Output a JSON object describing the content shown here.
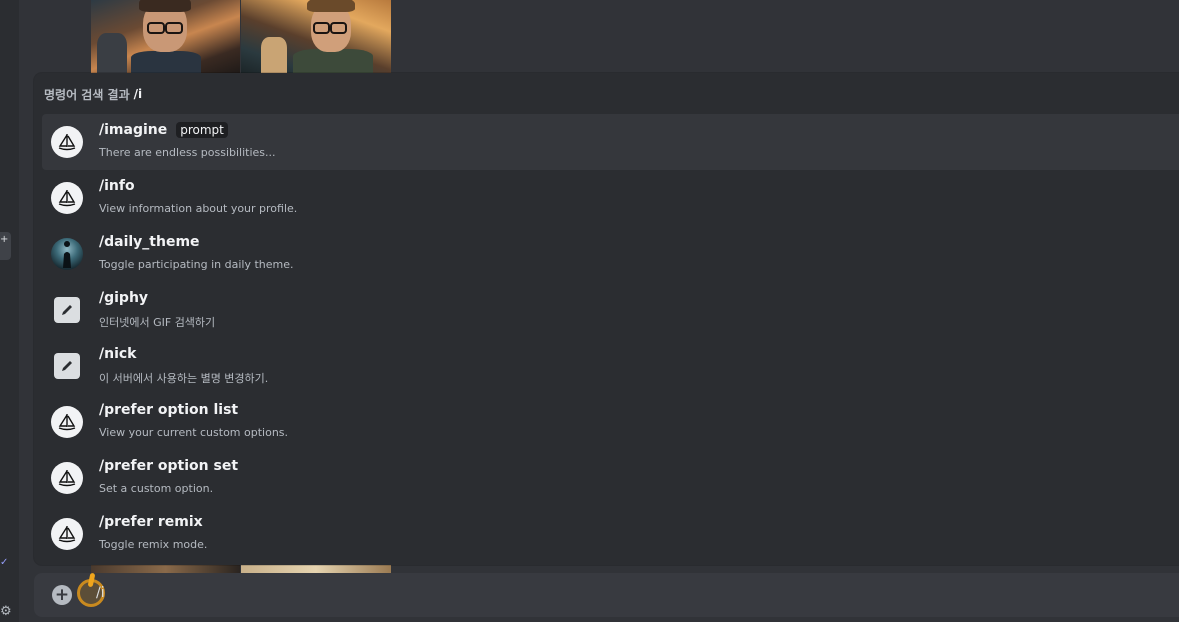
{
  "popup": {
    "header_label": "명령어 검색 결과",
    "header_query": "/i",
    "commands": [
      {
        "name": "/imagine",
        "param": "prompt",
        "description": "There are endless possibilities...",
        "icon": "midjourney-boat-icon"
      },
      {
        "name": "/info",
        "param": "",
        "description": "View information about your profile.",
        "icon": "midjourney-boat-icon"
      },
      {
        "name": "/daily_theme",
        "param": "",
        "description": "Toggle participating in daily theme.",
        "icon": "daily-theme-avatar-icon"
      },
      {
        "name": "/giphy",
        "param": "",
        "description": "인터넷에서 GIF 검색하기",
        "icon": "pencil-icon"
      },
      {
        "name": "/nick",
        "param": "",
        "description": "이 서버에서 사용하는 별명 변경하기.",
        "icon": "pencil-icon"
      },
      {
        "name": "/prefer option list",
        "param": "",
        "description": "View your current custom options.",
        "icon": "midjourney-boat-icon"
      },
      {
        "name": "/prefer option set",
        "param": "",
        "description": "Set a custom option.",
        "icon": "midjourney-boat-icon"
      },
      {
        "name": "/prefer remix",
        "param": "",
        "description": "Toggle remix mode.",
        "icon": "midjourney-boat-icon"
      }
    ]
  },
  "composer": {
    "value": "/i",
    "plus_icon": "plus-circle-icon"
  },
  "colors": {
    "background": "#313338",
    "popup": "#2b2d31",
    "selected_row": "#35373c",
    "composer": "#383a40",
    "cursor_highlight": "#c98a1f"
  }
}
